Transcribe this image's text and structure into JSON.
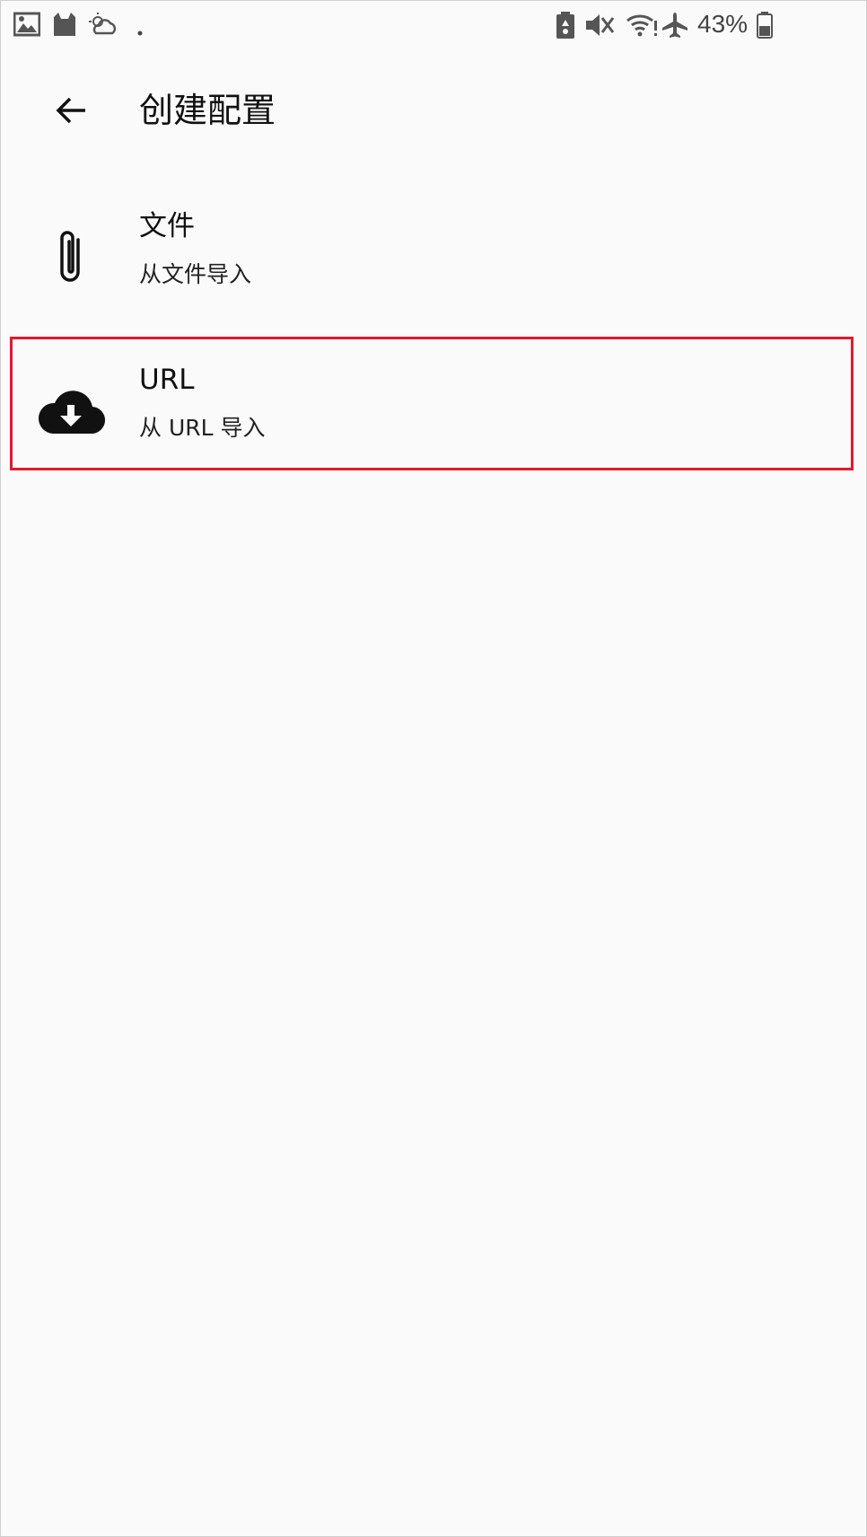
{
  "status_bar": {
    "battery_percent": "43%",
    "icons": [
      "gallery-icon",
      "cat-icon",
      "weather-icon",
      "dot-icon",
      "battery-saver-icon",
      "mute-icon",
      "wifi-icon",
      "airplane-icon",
      "battery-icon"
    ]
  },
  "app_bar": {
    "title": "创建配置",
    "back_icon": "arrow-back-icon"
  },
  "options": [
    {
      "icon": "paperclip-icon",
      "title": "文件",
      "subtitle": "从文件导入"
    },
    {
      "icon": "cloud-download-icon",
      "title": "URL",
      "subtitle": "从 URL 导入"
    }
  ],
  "colors": {
    "background": "#fafafa",
    "text": "#111111",
    "highlight": "#e3192c"
  }
}
